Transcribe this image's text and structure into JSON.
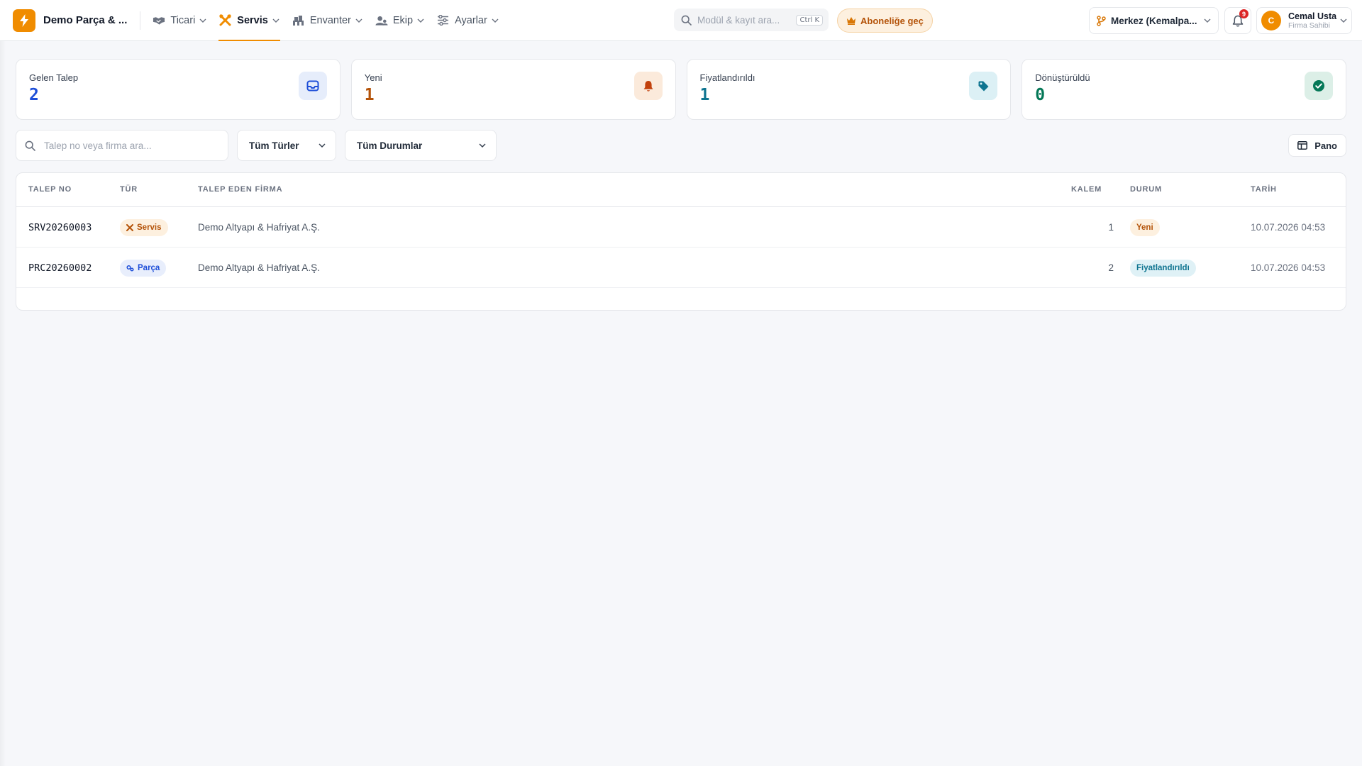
{
  "brand": {
    "name": "Demo Parça & ..."
  },
  "nav": [
    {
      "label": "Ticari",
      "icon": "handshake-icon",
      "active": false
    },
    {
      "label": "Servis",
      "icon": "tools-icon",
      "active": true
    },
    {
      "label": "Envanter",
      "icon": "warehouse-icon",
      "active": false
    },
    {
      "label": "Ekip",
      "icon": "team-icon",
      "active": false
    },
    {
      "label": "Ayarlar",
      "icon": "sliders-icon",
      "active": false
    }
  ],
  "search": {
    "placeholder": "Modül & kayıt ara...",
    "shortcut": "Ctrl K"
  },
  "upgrade": {
    "label": "Aboneliğe geç"
  },
  "branch": {
    "label": "Merkez (Kemalpa..."
  },
  "notifications": {
    "count": "9"
  },
  "user": {
    "initial": "C",
    "name": "Cemal Usta",
    "role": "Firma Sahibi"
  },
  "stats": [
    {
      "label": "Gelen Talep",
      "value": "2",
      "color": "#1d4ed8",
      "icon": "inbox-icon"
    },
    {
      "label": "Yeni",
      "value": "1",
      "color": "#b45309",
      "icon": "bell-icon"
    },
    {
      "label": "Fiyatlandırıldı",
      "value": "1",
      "color": "#0e7490",
      "icon": "tag-icon"
    },
    {
      "label": "Dönüştürüldü",
      "value": "0",
      "color": "#047857",
      "icon": "check-circle-icon"
    }
  ],
  "filters": {
    "search_placeholder": "Talep no veya firma ara...",
    "type_select": "Tüm Türler",
    "status_select": "Tüm Durumlar",
    "board_button": "Pano"
  },
  "table": {
    "headers": [
      "TALEP NO",
      "TÜR",
      "TALEP EDEN FİRMA",
      "KALEM",
      "DURUM",
      "TARİH"
    ],
    "rows": [
      {
        "no": "SRV20260003",
        "type": "Servis",
        "firm": "Demo Altyapı & Hafriyat A.Ş.",
        "qty": "1",
        "status": "Yeni",
        "date": "10.07.2026 04:53"
      },
      {
        "no": "PRC20260002",
        "type": "Parça",
        "firm": "Demo Altyapı & Hafriyat A.Ş.",
        "qty": "2",
        "status": "Fiyatlandırıldı",
        "date": "10.07.2026 04:53"
      }
    ]
  }
}
